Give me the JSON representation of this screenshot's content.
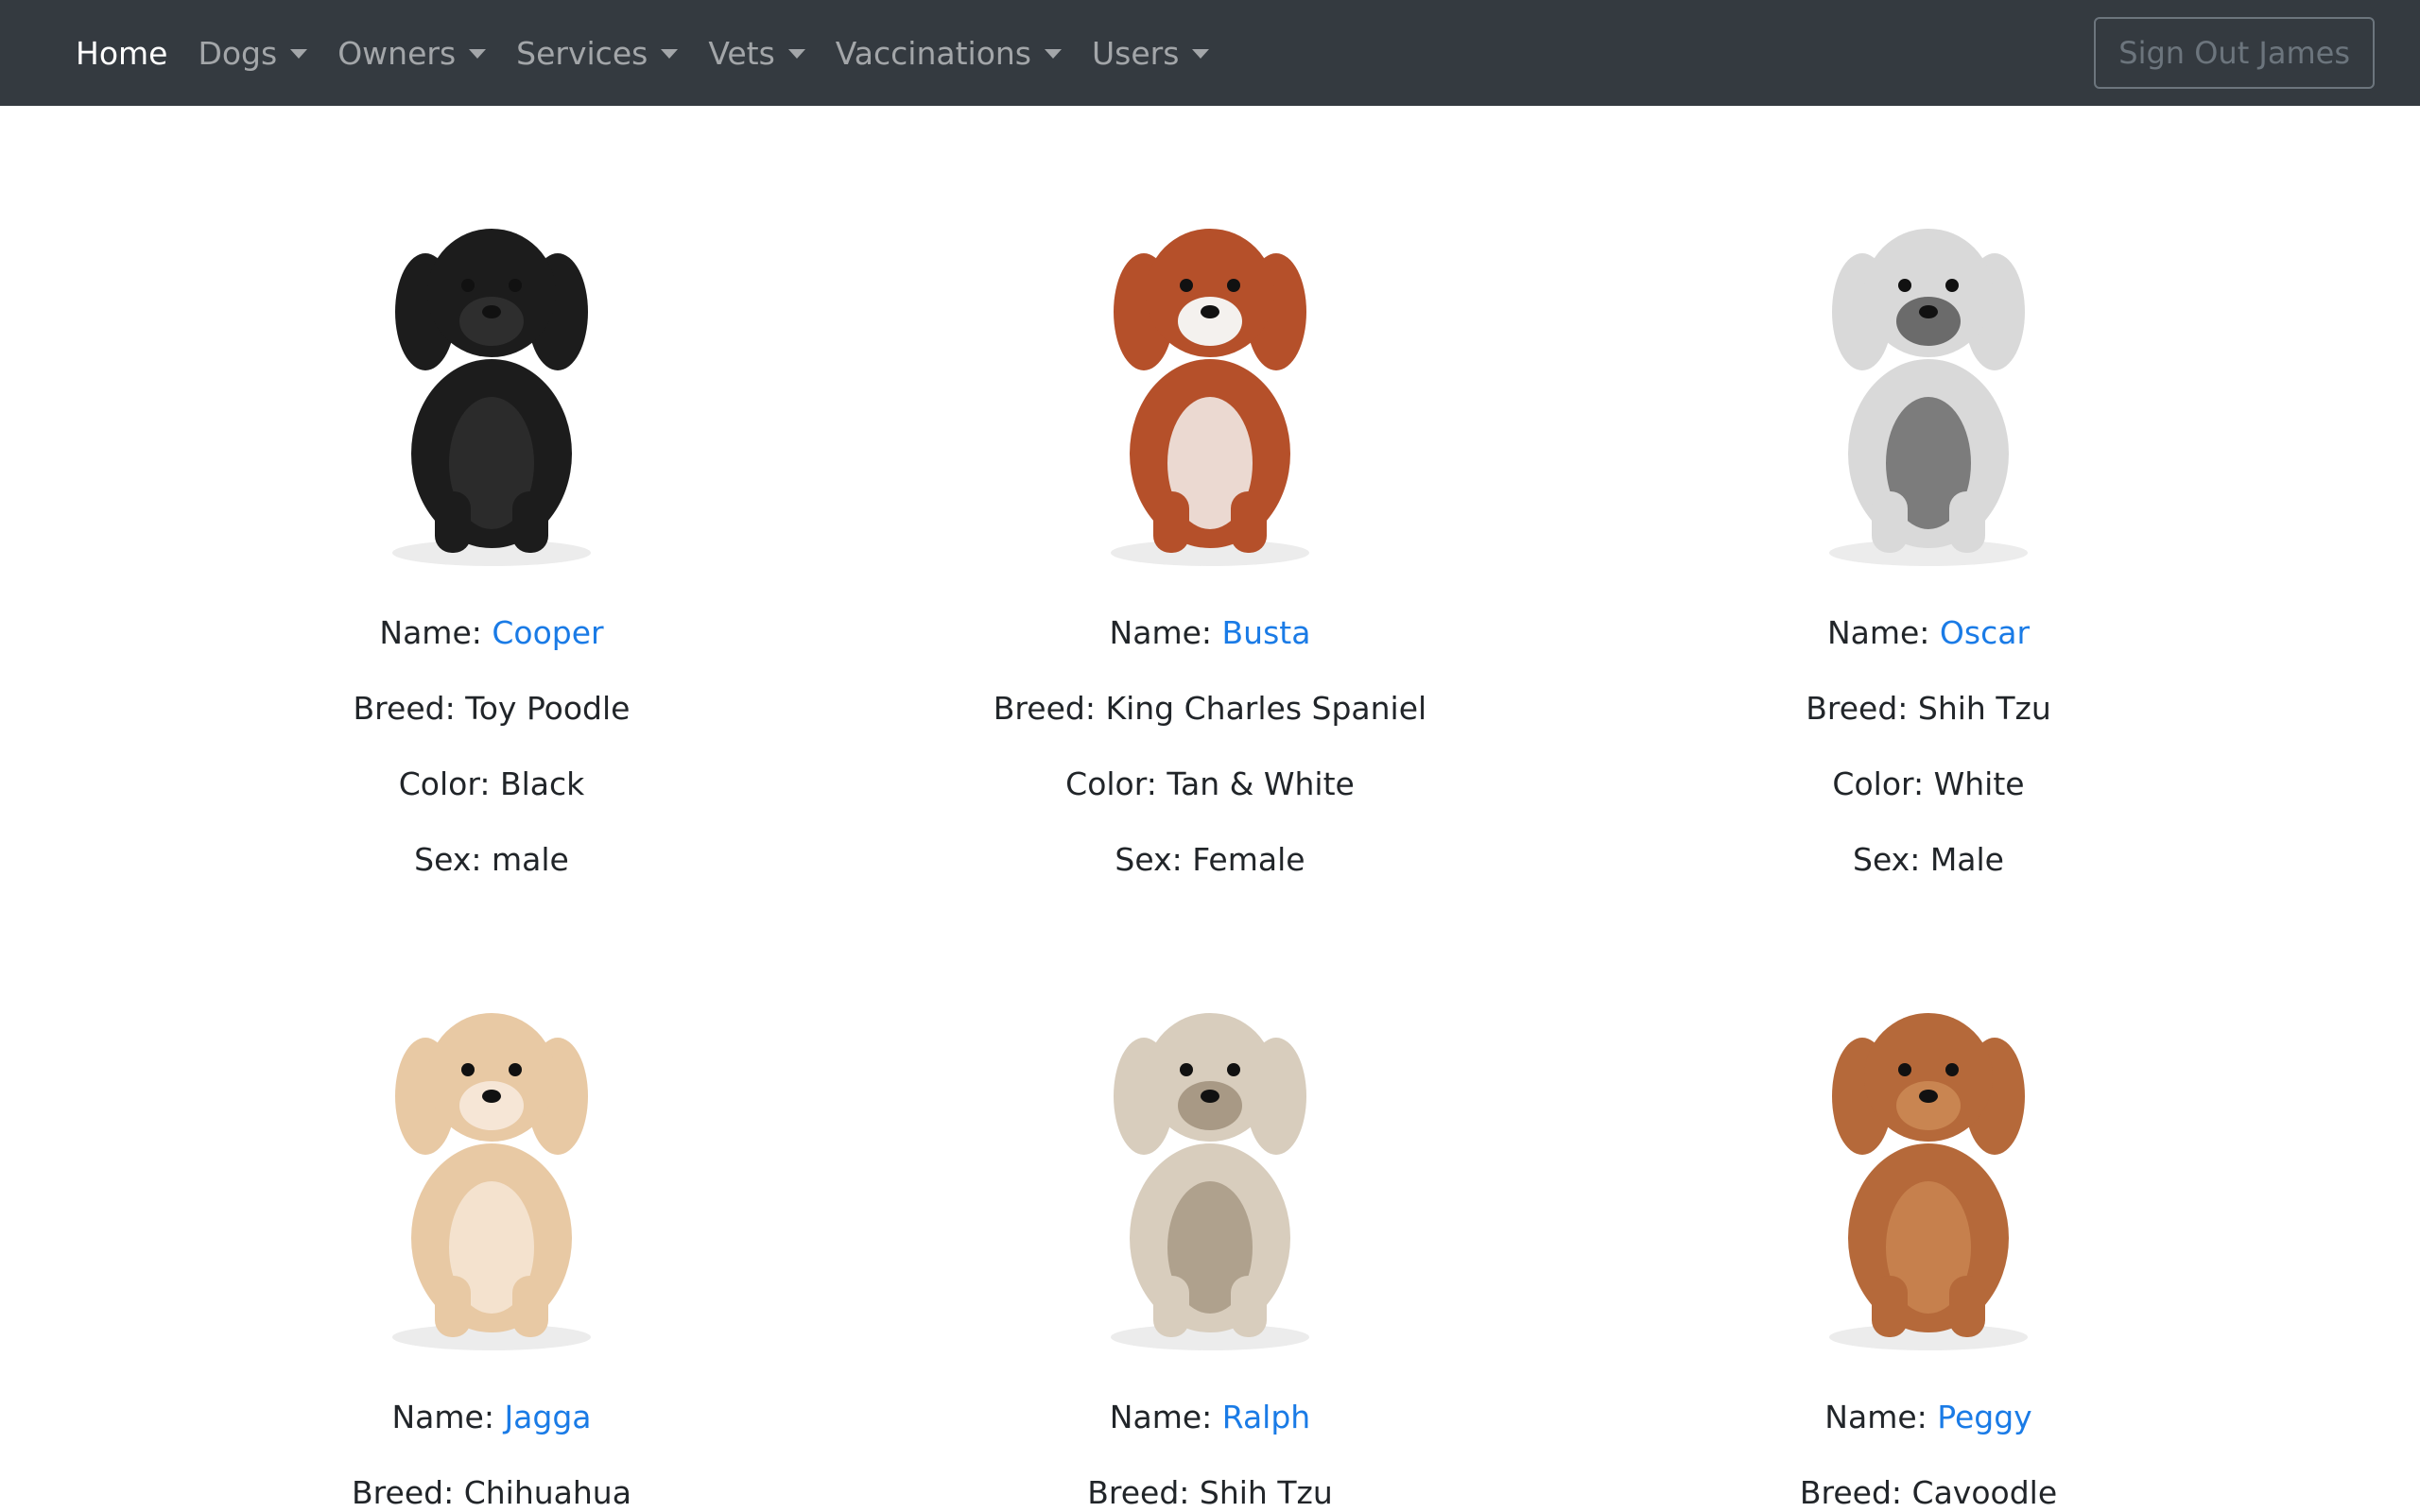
{
  "nav": {
    "items": [
      {
        "label": "Home",
        "dropdown": false,
        "active": true
      },
      {
        "label": "Dogs",
        "dropdown": true,
        "active": false
      },
      {
        "label": "Owners",
        "dropdown": true,
        "active": false
      },
      {
        "label": "Services",
        "dropdown": true,
        "active": false
      },
      {
        "label": "Vets",
        "dropdown": true,
        "active": false
      },
      {
        "label": "Vaccinations",
        "dropdown": true,
        "active": false
      },
      {
        "label": "Users",
        "dropdown": true,
        "active": false
      }
    ],
    "signout_label": "Sign Out James"
  },
  "labels": {
    "name": "Name: ",
    "breed": "Breed: ",
    "color": "Color: ",
    "sex": "Sex: "
  },
  "dogs": [
    {
      "name": "Cooper",
      "breed": "Toy Poodle",
      "color": "Black",
      "sex": "male",
      "photo_icon": "black-poodle-photo",
      "fur": "#1c1c1c",
      "fur2": "#2e2e2e"
    },
    {
      "name": "Busta",
      "breed": "King Charles Spaniel",
      "color": "Tan & White",
      "sex": "Female",
      "photo_icon": "spaniel-photo",
      "fur": "#b5502a",
      "fur2": "#f4f1ee"
    },
    {
      "name": "Oscar",
      "breed": "Shih Tzu",
      "color": "White",
      "sex": "Male",
      "photo_icon": "shih-tzu-photo",
      "fur": "#d9d9d9",
      "fur2": "#6b6b6b"
    },
    {
      "name": "Jagga",
      "breed": "Chihuahua",
      "color": "",
      "sex": "",
      "photo_icon": "chihuahua-photo",
      "fur": "#e8c9a4",
      "fur2": "#f6e6d6"
    },
    {
      "name": "Ralph",
      "breed": "Shih Tzu",
      "color": "",
      "sex": "",
      "photo_icon": "shih-tzu-photo",
      "fur": "#d8cdbd",
      "fur2": "#a89985"
    },
    {
      "name": "Peggy",
      "breed": "Cavoodle",
      "color": "",
      "sex": "",
      "photo_icon": "cavoodle-photo",
      "fur": "#b5693a",
      "fur2": "#c98551"
    }
  ]
}
